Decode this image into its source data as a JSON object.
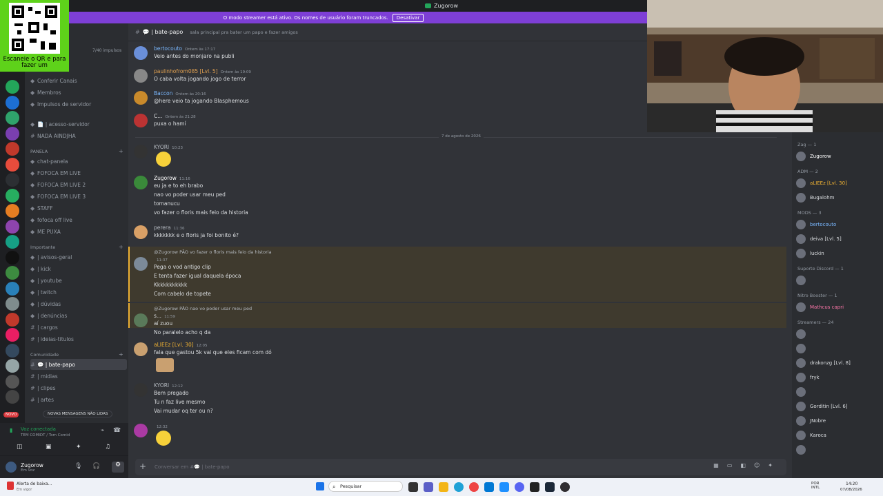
{
  "window": {
    "title": "Zugorow"
  },
  "banner": {
    "text": "O modo streamer está ativo. Os nomes de usuário foram truncados.",
    "button": "Desativar"
  },
  "qr": {
    "text": "Escaneie o QR e para fazer um"
  },
  "channels": {
    "boosts": "7/40 impulsos",
    "items": [
      {
        "label": "Conferir Canais",
        "icon": "check-icon"
      },
      {
        "label": "Membros",
        "icon": "members-icon"
      },
      {
        "label": "Impulsos de servidor",
        "icon": "boost-icon"
      },
      {
        "label": "📄 | acesso-servidor",
        "icon": "rules-icon"
      },
      {
        "label": "NADA AINDJHA",
        "icon": "hash-icon"
      }
    ],
    "cat_panela": "PANELA",
    "panela": [
      "chat-panela",
      "FOFOCA EM LIVE",
      "FOFOCA EM LIVE 2",
      "FOFOCA EM LIVE 3",
      "STAFF",
      "fofoca off live",
      "ME PUXA"
    ],
    "cat_importante": "Importante",
    "importante": [
      "| avisos-geral",
      "| kick",
      "| youtube",
      "| twitch",
      "| dúvidas",
      "| denúncias",
      "| cargos",
      "| ideias-titulos"
    ],
    "cat_comunidade": "Comunidade",
    "comunidade": [
      "💬 | bate-papo",
      "| midias",
      "| clipes",
      "| artes"
    ],
    "new_messages": "NOVAS MENSAGENS NÃO LIDAS",
    "novo": "NOVO"
  },
  "voice": {
    "status": "Voz conectada",
    "channel": "TEM COMIDT / Tom Comid"
  },
  "user": {
    "name": "Zugorow",
    "status": "Em voz"
  },
  "channel_header": {
    "name": "💬 | bate-papo",
    "topic": "sala principal pra bater um papo e fazer amigos"
  },
  "messages": [
    {
      "author": "bertocouto",
      "time": "Ontem às 17:17",
      "color": "#7ab8ff",
      "lines": [
        "Veio antes do monjaro na publi"
      ]
    },
    {
      "author": "paulinhofrom085 [Lvl. 5]",
      "time": "Ontem às 19:09",
      "color": "#e0a050",
      "lines": [
        "O caba volta jogando jogo de terror"
      ]
    },
    {
      "author": "Baccon",
      "time": "Ontem às 20:16",
      "color": "#7ab8ff",
      "lines": [
        "@here veio ta jogando Blasphemous"
      ]
    },
    {
      "author": "C...",
      "time": "Ontem às 21:28",
      "color": "#dbdee1",
      "lines": [
        "puxa o hamí"
      ]
    },
    {
      "author": "KYORI",
      "time": "10:23",
      "color": "#b5bac1",
      "lines": []
    },
    {
      "author": "Zugorow",
      "time": "11:16",
      "color": "#ffffff",
      "lines": [
        "eu ja e to eh brabo",
        "nao vo poder usar meu ped",
        "tomanucu",
        "vo fazer o floris mais feio da historia"
      ]
    },
    {
      "author": "perera",
      "time": "11:36",
      "color": "#b5bac1",
      "lines": [
        "kkkkkkk e o floris ja foi bonito é?"
      ]
    },
    {
      "author": "",
      "time": "11:37",
      "color": "#5865f2",
      "reply": "@Zugorow PÃO vo fazer o floris mais feio da historia",
      "lines": [
        "Pega o vod antigo clip",
        "E tenta fazer igual daquela época",
        "Kkkkkkkkkkk",
        "Com cabelo de topete"
      ]
    },
    {
      "author": "s...",
      "time": "11:59",
      "color": "#dbdee1",
      "reply": "@Zugorow PÃO nao vo poder usar meu ped",
      "lines": [
        "aí zuou",
        "No paralelo acho q da"
      ]
    },
    {
      "author": "aLIEEz [Lvl. 30]",
      "time": "12:05",
      "color": "#f0b232",
      "lines": [
        "fala que gastou 5k vai que eles ficam com dó"
      ]
    },
    {
      "author": "KYORI",
      "time": "12:12",
      "color": "#b5bac1",
      "lines": [
        "Bem pregado",
        "Tu n faz live mesmo",
        "Vai mudar oq ter ou n?"
      ]
    },
    {
      "author": "",
      "time": "12:32",
      "color": "#c94cc9",
      "lines": []
    }
  ],
  "date_divider": "7 de agosto de 2026",
  "input": {
    "placeholder": "Conversar em #💬 | bate-papo"
  },
  "members": {
    "groups": [
      {
        "label": "Zag — 1",
        "items": [
          "Zugorow"
        ]
      },
      {
        "label": "ADM — 2",
        "items": [
          "aLIEEz [Lvl. 30]",
          "Bugalohm"
        ]
      },
      {
        "label": "MODS — 3",
        "items": [
          "bertocouto",
          "deiva [Lvl. 5]",
          "luckin"
        ]
      },
      {
        "label": "Suporte Discord — 1",
        "items": [
          ""
        ]
      },
      {
        "label": "Nitro Booster — 1",
        "items": [
          "Mathcus capri"
        ]
      },
      {
        "label": "Streamers — 24",
        "items": [
          "",
          "",
          "drakonzg [Lvl. 8]",
          "fryk",
          "",
          "Gorditin [Lvl. 6]",
          "JNobre",
          "Karoca",
          ""
        ]
      }
    ]
  },
  "taskbar": {
    "alert": "Alerta de baixa...",
    "alert_sub": "Em vigor",
    "search": "Pesquisar",
    "lang": "POR INTL",
    "time": "14:20",
    "date": "07/08/2026"
  }
}
